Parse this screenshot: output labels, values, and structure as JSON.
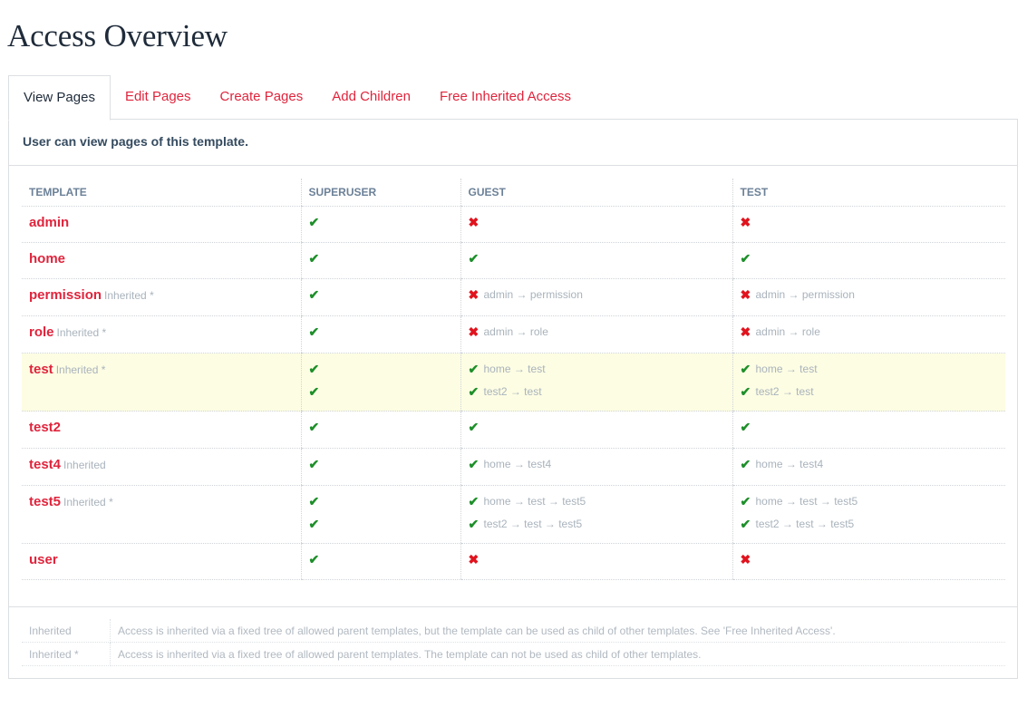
{
  "page": {
    "title": "Access Overview"
  },
  "tabs": [
    {
      "label": "View Pages",
      "active": true
    },
    {
      "label": "Edit Pages",
      "active": false
    },
    {
      "label": "Create Pages",
      "active": false
    },
    {
      "label": "Add Children",
      "active": false
    },
    {
      "label": "Free Inherited Access",
      "active": false
    }
  ],
  "panel": {
    "description": "User can view pages of this template."
  },
  "table": {
    "columns": [
      "TEMPLATE",
      "SUPERUSER",
      "GUEST",
      "TEST"
    ],
    "rows": [
      {
        "name": "admin",
        "note": "",
        "superuser": [
          {
            "ok": true,
            "path": ""
          }
        ],
        "guest": [
          {
            "ok": false,
            "path": ""
          }
        ],
        "test": [
          {
            "ok": false,
            "path": ""
          }
        ]
      },
      {
        "name": "home",
        "note": "",
        "superuser": [
          {
            "ok": true,
            "path": ""
          }
        ],
        "guest": [
          {
            "ok": true,
            "path": ""
          }
        ],
        "test": [
          {
            "ok": true,
            "path": ""
          }
        ]
      },
      {
        "name": "permission",
        "note": "Inherited *",
        "superuser": [
          {
            "ok": true,
            "path": ""
          }
        ],
        "guest": [
          {
            "ok": false,
            "path": "admin → permission"
          }
        ],
        "test": [
          {
            "ok": false,
            "path": "admin → permission"
          }
        ]
      },
      {
        "name": "role",
        "note": "Inherited *",
        "superuser": [
          {
            "ok": true,
            "path": ""
          }
        ],
        "guest": [
          {
            "ok": false,
            "path": "admin → role"
          }
        ],
        "test": [
          {
            "ok": false,
            "path": "admin → role"
          }
        ]
      },
      {
        "name": "test",
        "note": "Inherited *",
        "highlighted": true,
        "superuser": [
          {
            "ok": true,
            "path": ""
          },
          {
            "ok": true,
            "path": ""
          }
        ],
        "guest": [
          {
            "ok": true,
            "path": "home → test"
          },
          {
            "ok": true,
            "path": "test2 → test"
          }
        ],
        "test": [
          {
            "ok": true,
            "path": "home → test"
          },
          {
            "ok": true,
            "path": "test2 → test"
          }
        ]
      },
      {
        "name": "test2",
        "note": "",
        "superuser": [
          {
            "ok": true,
            "path": ""
          }
        ],
        "guest": [
          {
            "ok": true,
            "path": ""
          }
        ],
        "test": [
          {
            "ok": true,
            "path": ""
          }
        ]
      },
      {
        "name": "test4",
        "note": "Inherited",
        "superuser": [
          {
            "ok": true,
            "path": ""
          }
        ],
        "guest": [
          {
            "ok": true,
            "path": "home → test4"
          }
        ],
        "test": [
          {
            "ok": true,
            "path": "home → test4"
          }
        ]
      },
      {
        "name": "test5",
        "note": "Inherited *",
        "superuser": [
          {
            "ok": true,
            "path": ""
          },
          {
            "ok": true,
            "path": ""
          }
        ],
        "guest": [
          {
            "ok": true,
            "path": "home → test → test5"
          },
          {
            "ok": true,
            "path": "test2 → test → test5"
          }
        ],
        "test": [
          {
            "ok": true,
            "path": "home → test → test5"
          },
          {
            "ok": true,
            "path": "test2 → test → test5"
          }
        ]
      },
      {
        "name": "user",
        "note": "",
        "superuser": [
          {
            "ok": true,
            "path": ""
          }
        ],
        "guest": [
          {
            "ok": false,
            "path": ""
          }
        ],
        "test": [
          {
            "ok": false,
            "path": ""
          }
        ]
      }
    ]
  },
  "icons": {
    "allowed": "check-icon",
    "denied": "cross-icon",
    "allowed_color": "#1e8f2a",
    "denied_color": "#e0141e"
  },
  "legend": [
    {
      "term": "Inherited",
      "text": "Access is inherited via a fixed tree of allowed parent templates, but the template can be used as child of other templates. See 'Free Inherited Access'."
    },
    {
      "term": "Inherited *",
      "text": "Access is inherited via a fixed tree of allowed parent templates. The template can not be used as child of other templates."
    }
  ]
}
